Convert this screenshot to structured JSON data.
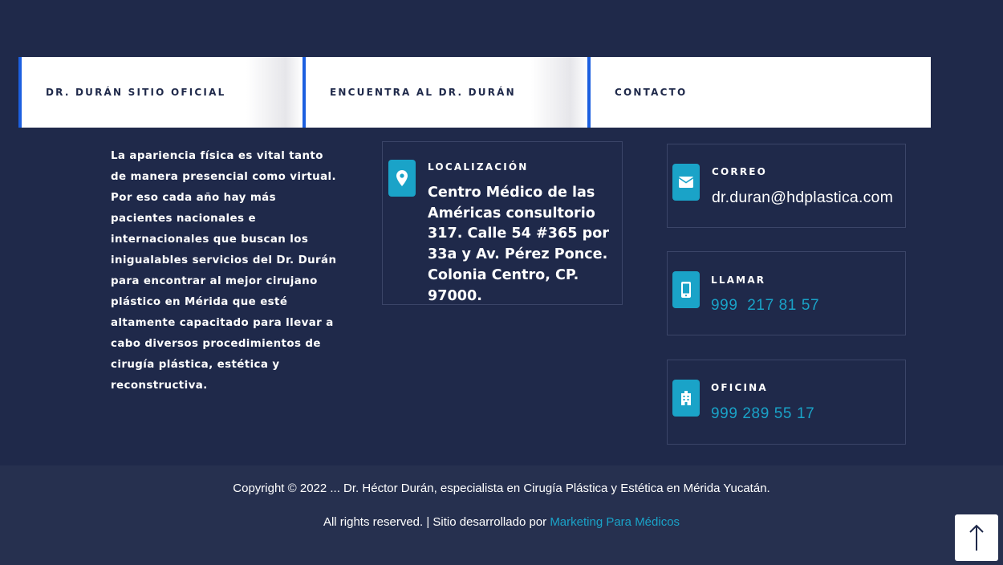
{
  "tabs": [
    {
      "label": "DR. DURÁN SITIO OFICIAL"
    },
    {
      "label": "ENCUENTRA AL DR. DURÁN"
    },
    {
      "label": "CONTACTO"
    }
  ],
  "about_text": "La apariencia física es vital tanto de manera presencial como virtual. Por eso cada año hay más pacientes nacionales e internacionales que buscan los inigualables servicios del Dr. Durán para encontrar al mejor cirujano plástico en Mérida que esté altamente capacitado para llevar a cabo diversos procedimientos de cirugía plástica, estética y reconstructiva.",
  "location": {
    "label": "LOCALIZACIÓN",
    "address": "Centro Médico de las Américas consultorio 317. Calle 54 #365 por 33a y Av. Pérez Ponce. Colonia Centro, CP. 97000.",
    "icon": "map-pin-icon"
  },
  "contacts": {
    "email": {
      "label": "CORREO",
      "value": "dr.duran@hdplastica.com",
      "icon": "envelope-icon"
    },
    "phone": {
      "label": "LLAMAR",
      "value": "999  217 81 57",
      "icon": "mobile-phone-icon"
    },
    "office": {
      "label": "OFICINA",
      "value": "999 289 55 17",
      "icon": "building-icon"
    }
  },
  "footer": {
    "copyright": "Copyright © 2022 ... Dr. Héctor Durán, especialista en Cirugía Plástica y Estética en Mérida Yucatán.",
    "rights": "All rights reserved. | Sitio desarrollado por ",
    "developer_link": "Marketing Para Médicos"
  },
  "scroll_top_icon": "arrow-up-icon",
  "colors": {
    "background": "#1f294a",
    "footer": "#26304f",
    "accent": "#1aa3c8",
    "tab_border": "#1c5fe0"
  }
}
